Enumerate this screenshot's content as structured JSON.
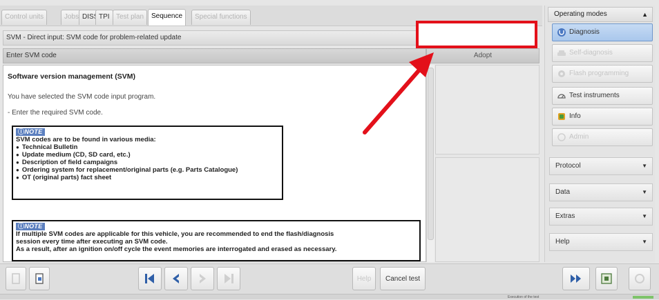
{
  "tabs": [
    {
      "label": "Control units",
      "state": "dim"
    },
    {
      "label": "Jobs",
      "state": "dim"
    },
    {
      "label": "DISS",
      "state": "normal"
    },
    {
      "label": "TPI",
      "state": "normal"
    },
    {
      "label": "Test plan",
      "state": "dim"
    },
    {
      "label": "Sequence",
      "state": "active"
    },
    {
      "label": "Special functions",
      "state": "dim"
    }
  ],
  "header": {
    "title": "SVM - Direct input: SVM code for problem-related update",
    "subtitle": "Enter SVM code"
  },
  "input": {
    "value": "",
    "adopt_label": "Adopt"
  },
  "content": {
    "title": "Software version management (SVM)",
    "line1": "You have selected the SVM code input program.",
    "line2": "- Enter the required SVM code.",
    "note1": {
      "badge": "NOTE",
      "heading": "SVM codes are to be found in various media:",
      "items": [
        "Technical Bulletin",
        "Update medium (CD, SD card, etc.)",
        "Description of field campaigns",
        "Ordering system for replacement/original parts (e.g. Parts Catalogue)",
        "OT (original parts) fact sheet"
      ]
    },
    "note2": {
      "badge": "NOTE",
      "line1": "If multiple SVM codes are applicable for this vehicle, you are recommended to end the flash/diagnosis",
      "line2": "session every time after executing an SVM code.",
      "line3": "As a result, after an ignition on/off cycle the event memories are interrogated and erased as necessary."
    }
  },
  "sidebar": {
    "operating_modes": {
      "title": "Operating modes",
      "items": [
        {
          "label": "Diagnosis",
          "icon": "stethoscope-icon",
          "state": "selected"
        },
        {
          "label": "Self-diagnosis",
          "icon": "car-icon",
          "state": "disabled"
        },
        {
          "label": "Flash programming",
          "icon": "gear-icon",
          "state": "disabled"
        },
        {
          "label": "Test instruments",
          "icon": "gauge-icon",
          "state": "normal"
        },
        {
          "label": "Info",
          "icon": "book-icon",
          "state": "normal"
        },
        {
          "label": "Admin",
          "icon": "admin-icon",
          "state": "disabled"
        }
      ]
    },
    "sections": [
      {
        "label": "Protocol"
      },
      {
        "label": "Data"
      },
      {
        "label": "Extras"
      },
      {
        "label": "Help"
      }
    ]
  },
  "toolbar": {
    "help_label": "Help",
    "cancel_label": "Cancel test"
  },
  "status": {
    "text": "Execution of the test"
  },
  "colors": {
    "highlight": "#e3101a",
    "arrow": "#e3101a",
    "note_badge": "#5b7fbf",
    "selected": "#a9c7ec"
  }
}
